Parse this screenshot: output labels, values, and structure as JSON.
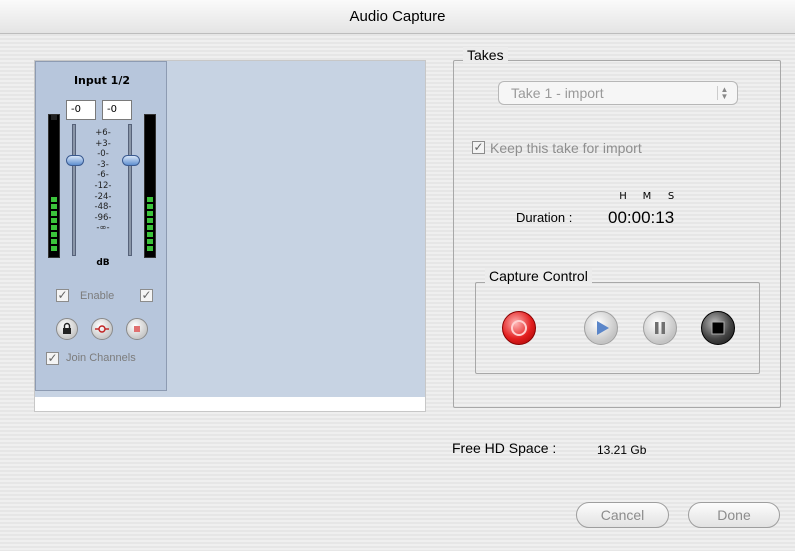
{
  "window": {
    "title": "Audio Capture"
  },
  "mixer": {
    "strip_title": "Input 1/2",
    "gain_left": "-0",
    "gain_right": "-0",
    "scale": [
      "+6-",
      "+3-",
      "-0-",
      "-3-",
      "-6-",
      "-12-",
      "-24-",
      "-48-",
      "-96-",
      "-∞-"
    ],
    "unit": "dB",
    "enable_label": "Enable",
    "enable_left_checked": true,
    "enable_right_checked": true,
    "join_label": "Join Channels",
    "join_checked": true,
    "lock_icon": "lock-icon",
    "link_icon": "link-icon",
    "mute_icon": "mute-icon"
  },
  "takes": {
    "title": "Takes",
    "selected_take": "Take 1 - import",
    "keep_label": "Keep this take for import",
    "keep_checked": true,
    "hms_labels": [
      "H",
      "M",
      "S"
    ],
    "duration_label": "Duration :",
    "duration_value": "00:00:13"
  },
  "capture": {
    "title": "Capture Control",
    "buttons": [
      "record-icon",
      "play-icon",
      "pause-icon",
      "stop-icon"
    ],
    "record_color": "#e31f1f"
  },
  "disk": {
    "free_label": "Free HD Space :",
    "free_value": "13.21 Gb"
  },
  "footer": {
    "cancel_label": "Cancel",
    "done_label": "Done"
  }
}
